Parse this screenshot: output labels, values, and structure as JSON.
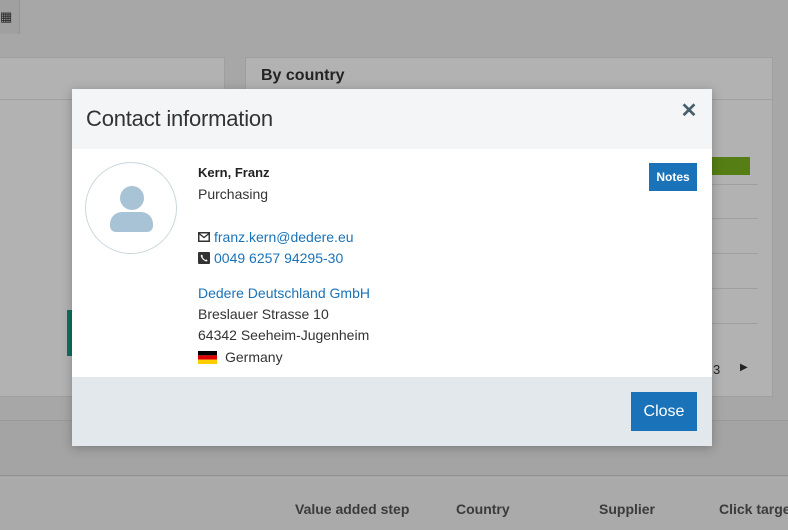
{
  "background": {
    "top_button_icon": "calendar-icon",
    "top_button_glyph": "▦",
    "panel_right_title": "By country",
    "pagination_page": "3",
    "pagination_next_glyph": "▶",
    "table_columns": [
      "Value added step",
      "Country",
      "Supplier",
      "Click targe"
    ]
  },
  "modal": {
    "title": "Contact information",
    "close_glyph": "✕",
    "contact": {
      "name": "Kern, Franz",
      "department": "Purchasing",
      "email": "franz.kern@dedere.eu",
      "phone": "0049 6257 94295-30",
      "company": "Dedere Deutschland GmbH",
      "street": "Breslauer Strasse 10",
      "city": "64342 Seeheim-Jugenheim",
      "country": "Germany"
    },
    "notes_label": "Notes",
    "close_label": "Close"
  },
  "colors": {
    "accent": "#1a73b8",
    "footer": "#e3e8ed",
    "avatar": "#a9c3d6",
    "progress": "#7ab51d"
  }
}
